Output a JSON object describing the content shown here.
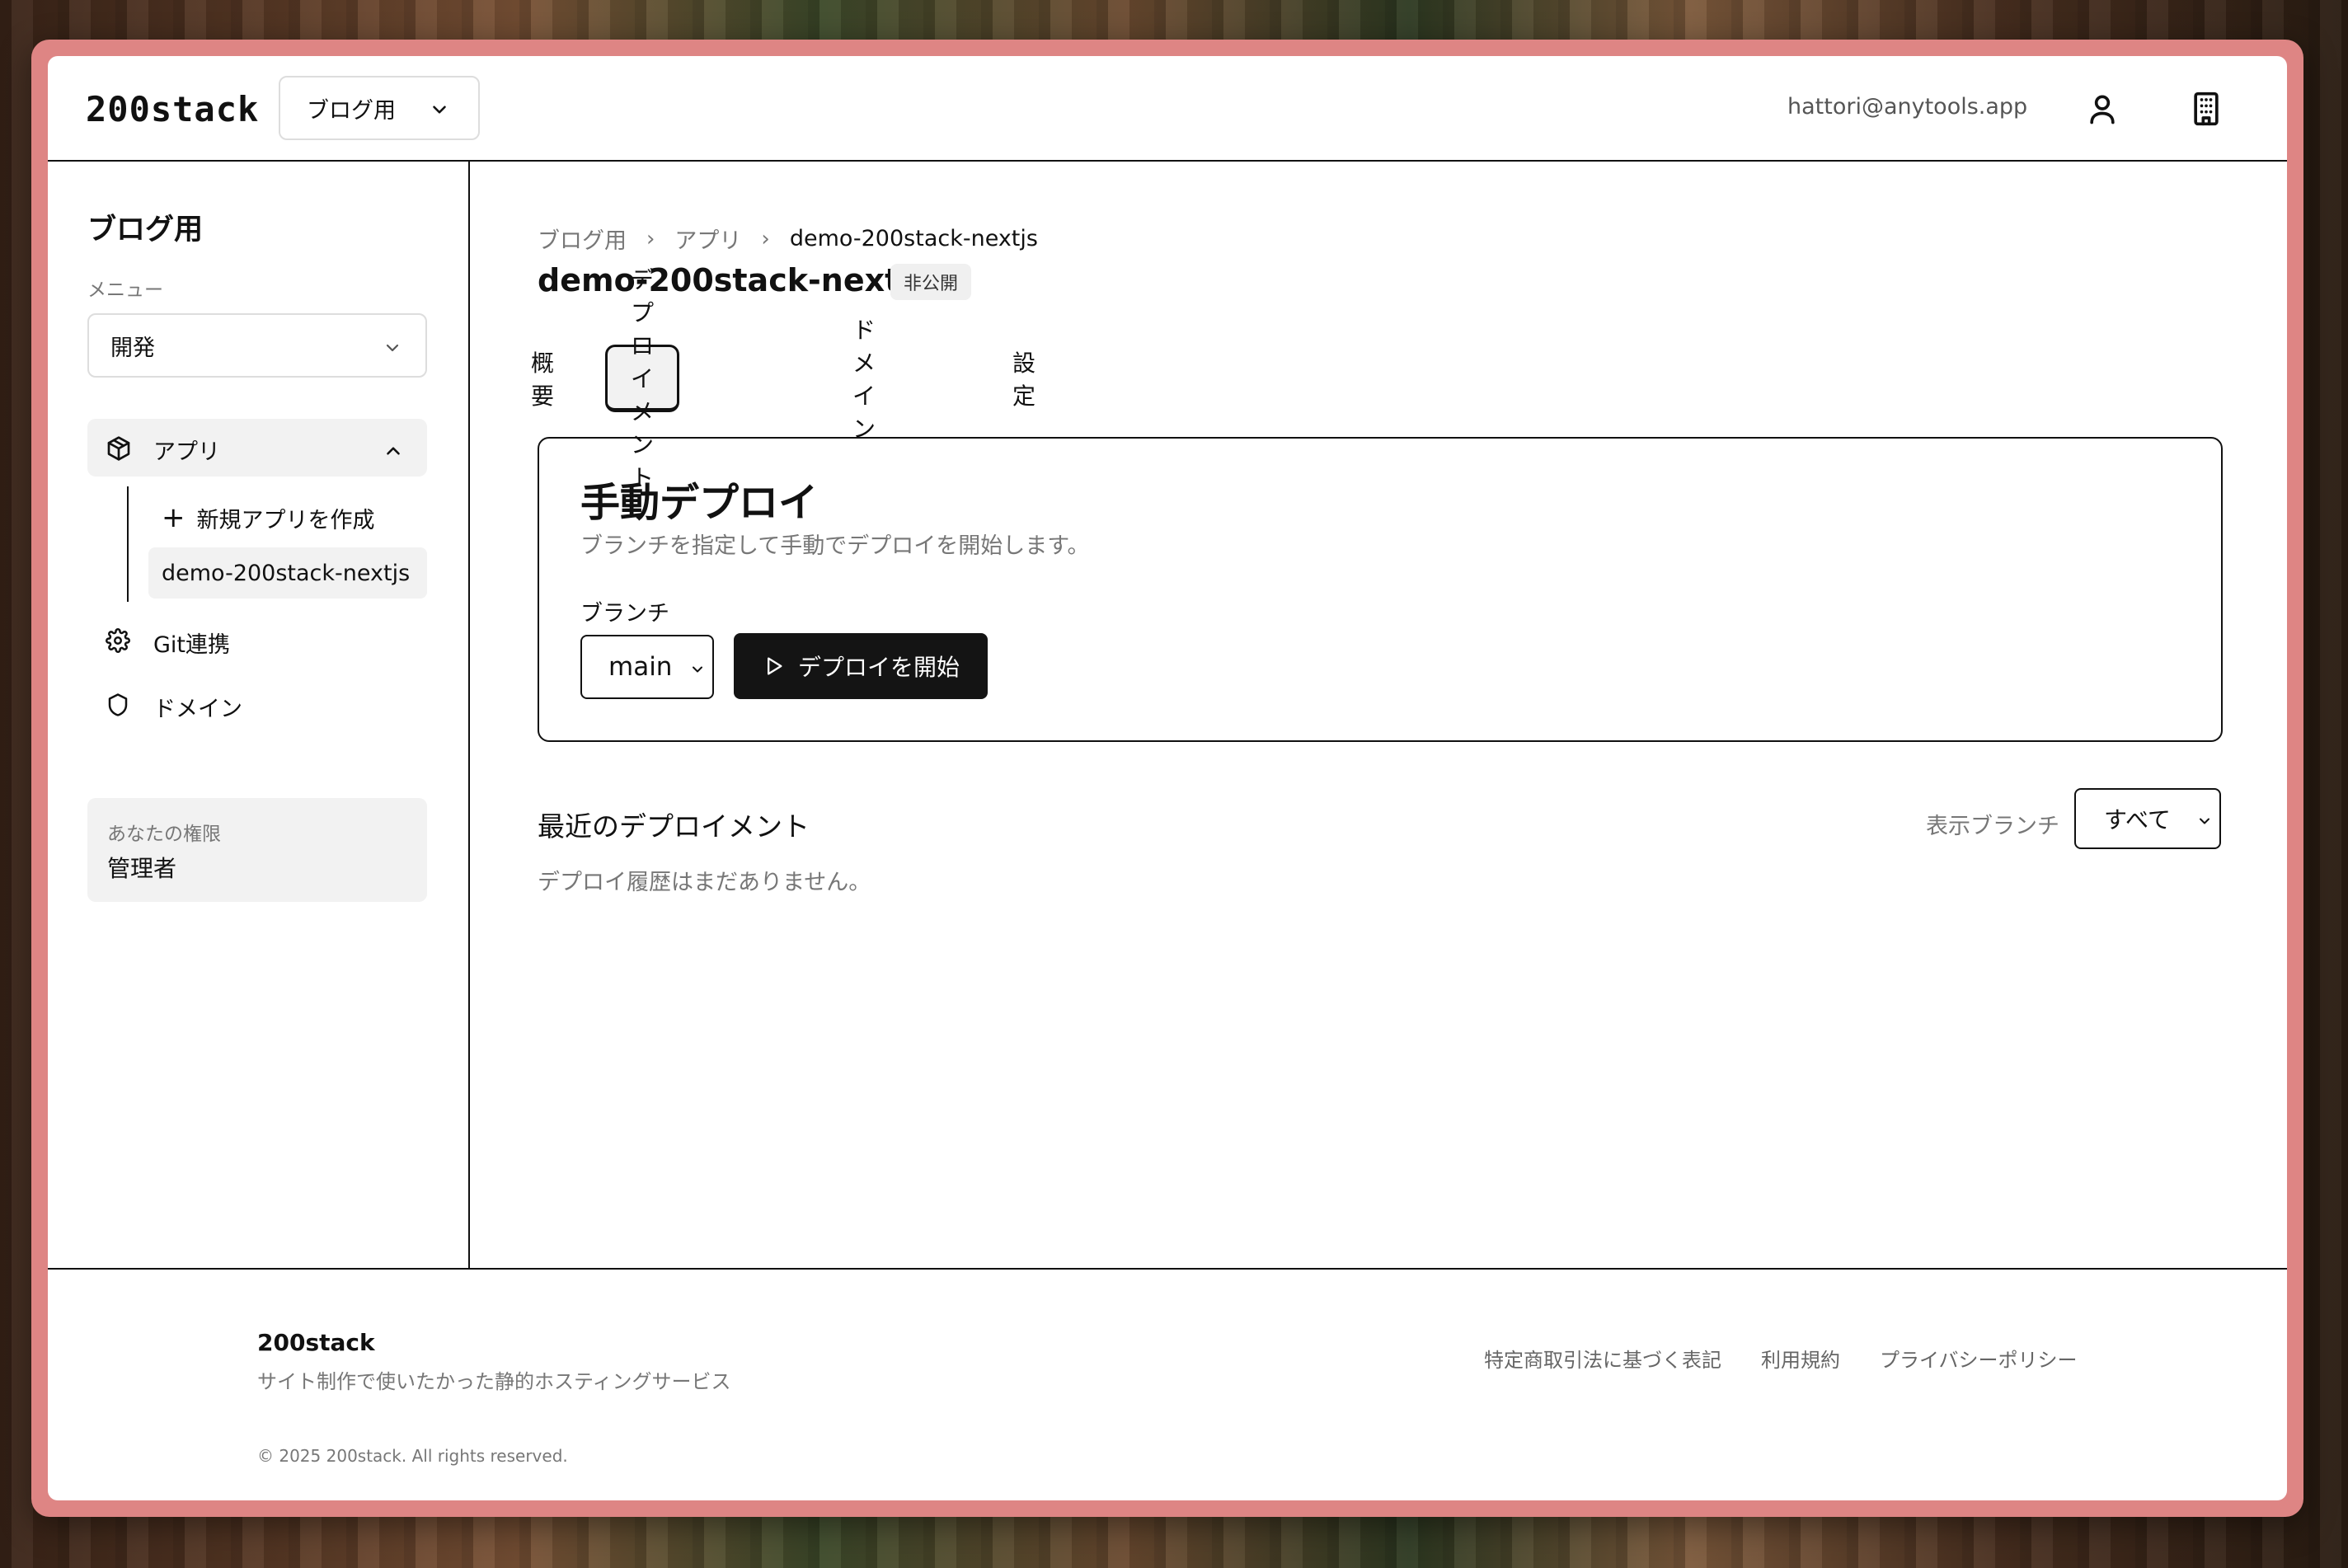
{
  "header": {
    "logo": "200stack",
    "project_select": "ブログ用",
    "email": "hattori@anytools.app"
  },
  "sidebar": {
    "title": "ブログ用",
    "menu_label": "メニュー",
    "menu_select": "開発",
    "nav": {
      "apps": "アプリ",
      "new_app": "新規アプリを作成",
      "app_item": "demo-200stack-nextjs",
      "git": "Git連携",
      "domain": "ドメイン"
    },
    "permission": {
      "label": "あなたの権限",
      "value": "管理者"
    }
  },
  "main": {
    "breadcrumb": [
      "ブログ用",
      "アプリ",
      "demo-200stack-nextjs"
    ],
    "breadcrumb_sep": "›",
    "title": "demo-200stack-nextjs",
    "badge": "非公開",
    "tabs": [
      {
        "label": "概要",
        "active": false
      },
      {
        "label": "デプロイメント",
        "active": true
      },
      {
        "label": "ドメイン",
        "active": false
      },
      {
        "label": "設定",
        "active": false
      }
    ],
    "manual_deploy": {
      "title": "手動デプロイ",
      "description": "ブランチを指定して手動でデプロイを開始します。",
      "branch_label": "ブランチ",
      "branch_value": "main",
      "start_button": "デプロイを開始"
    },
    "recent": {
      "title": "最近のデプロイメント",
      "filter_label": "表示ブランチ",
      "filter_value": "すべて",
      "empty_message": "デプロイ履歴はまだありません。"
    }
  },
  "footer": {
    "brand": "200stack",
    "tagline": "サイト制作で使いたかった静的ホスティングサービス",
    "copyright": "© 2025 200stack. All rights reserved.",
    "links": [
      "特定商取引法に基づく表記",
      "利用規約",
      "プライバシーポリシー"
    ]
  },
  "colors": {
    "frame": "#de8584",
    "primary_button": "#141414",
    "muted_text": "#777777"
  }
}
